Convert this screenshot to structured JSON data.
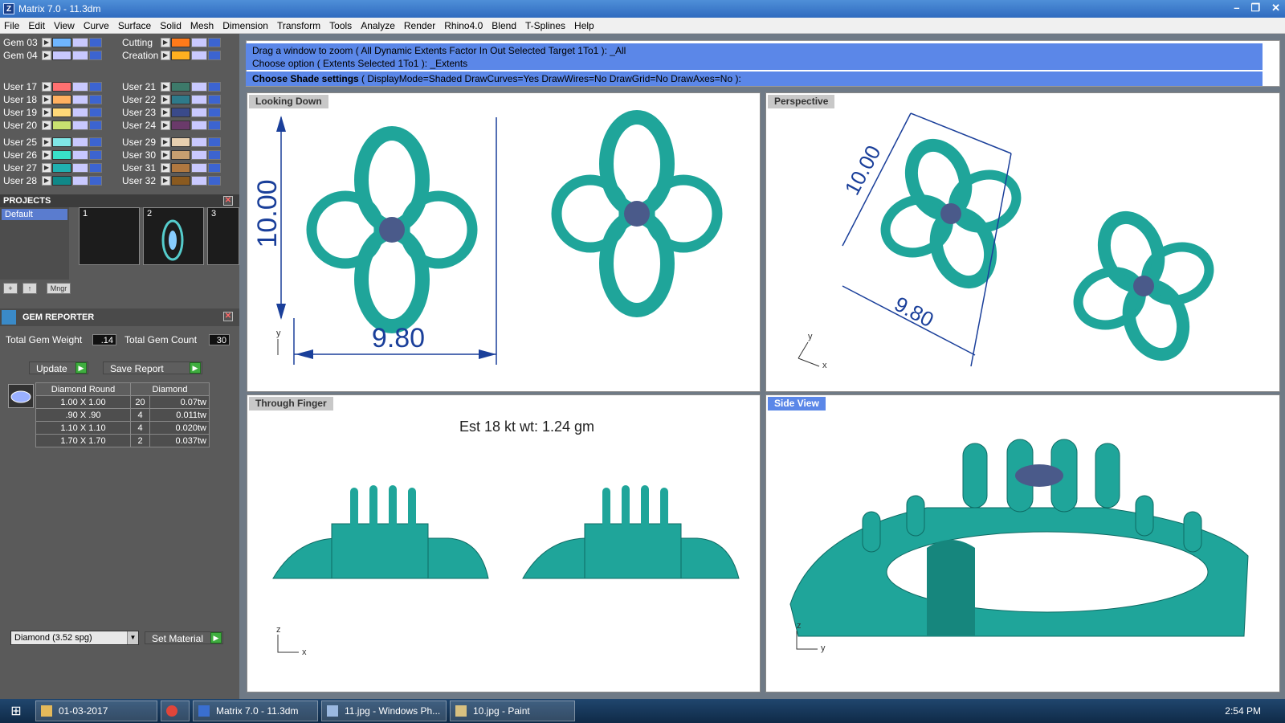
{
  "window": {
    "title": "Matrix 7.0 - 11.3dm",
    "app_icon": "Z"
  },
  "menu": [
    "File",
    "Edit",
    "View",
    "Curve",
    "Surface",
    "Solid",
    "Mesh",
    "Dimension",
    "Transform",
    "Tools",
    "Analyze",
    "Render",
    "Rhino4.0",
    "Blend",
    "T-Splines",
    "Help"
  ],
  "layers": {
    "left": [
      {
        "name": "Gem 03",
        "color": "#6fb6ff"
      },
      {
        "name": "Gem 04",
        "color": "#c8c8ff"
      },
      {
        "name": "User 17",
        "color": "#ff7070"
      },
      {
        "name": "User 18",
        "color": "#ffb060"
      },
      {
        "name": "User 19",
        "color": "#ffd878"
      },
      {
        "name": "User 20",
        "color": "#c8e070"
      },
      {
        "name": "User 25",
        "color": "#7fe6e6"
      },
      {
        "name": "User 26",
        "color": "#38e0c8"
      },
      {
        "name": "User 27",
        "color": "#20b0b0"
      },
      {
        "name": "User 28",
        "color": "#108888"
      }
    ],
    "right": [
      {
        "name": "Cutting",
        "color": "#ff7a1a"
      },
      {
        "name": "Creation",
        "color": "#ffb020"
      },
      {
        "name": "User 21",
        "color": "#3d7a6a"
      },
      {
        "name": "User 22",
        "color": "#2e7a8a"
      },
      {
        "name": "User 23",
        "color": "#3a4a8a"
      },
      {
        "name": "User 24",
        "color": "#6a3a6a"
      },
      {
        "name": "User 29",
        "color": "#e8d0b0"
      },
      {
        "name": "User 30",
        "color": "#c8a070"
      },
      {
        "name": "User 31",
        "color": "#b07840"
      },
      {
        "name": "User 32",
        "color": "#8a5a20"
      }
    ]
  },
  "projects": {
    "header": "PROJECTS",
    "default": "Default",
    "slots": [
      "1",
      "2",
      "3"
    ],
    "mngr": "Mngr"
  },
  "gem_reporter": {
    "header": "GEM REPORTER",
    "total_weight_label": "Total Gem Weight",
    "total_weight": ".14",
    "total_count_label": "Total Gem Count",
    "total_count": "30",
    "update": "Update",
    "save_report": "Save Report",
    "table": {
      "headers": [
        "Diamond Round",
        "Diamond"
      ],
      "rows": [
        {
          "size": "1.00 X 1.00",
          "count": "20",
          "wt": "0.07tw"
        },
        {
          "size": ".90 X .90",
          "count": "4",
          "wt": "0.011tw"
        },
        {
          "size": "1.10 X 1.10",
          "count": "4",
          "wt": "0.020tw"
        },
        {
          "size": "1.70 X 1.70",
          "count": "2",
          "wt": "0.037tw"
        }
      ]
    },
    "material": "Diamond      (3.52 spg)",
    "set_material": "Set Material"
  },
  "command": {
    "history1": "Drag a window to zoom ( All  Dynamic  Extents  Factor  In  Out  Selected  Target  1To1 ): _All",
    "history2": "Choose option ( Extents  Selected  1To1 ): _Extents",
    "prompt_label": "Choose Shade settings",
    "prompt_rest": "( DisplayMode=Shaded  DrawCurves=Yes  DrawWires=No  DrawGrid=No  DrawAxes=No ):"
  },
  "viewports": {
    "top_left": {
      "title": "Looking Down",
      "dim_v": "10.00",
      "dim_h": "9.80",
      "axis": "y"
    },
    "top_right": {
      "title": "Perspective",
      "dim_v": "10.00",
      "dim_h": "9.80",
      "axis_y": "y",
      "axis_x": "x"
    },
    "bottom_left": {
      "title": "Through Finger",
      "note": "Est 18 kt wt: 1.24 gm",
      "axis_z": "z",
      "axis_x": "x"
    },
    "bottom_right": {
      "title": "Side View",
      "axis_z": "z",
      "axis_y": "y"
    }
  },
  "colors": {
    "model": "#1fa59a",
    "model_dark": "#0e6b64",
    "gem": "#4a5a8a",
    "dim": "#1a3f9a",
    "active": "#5b87e8"
  },
  "taskbar": {
    "items": [
      "01-03-2017",
      "Matrix 7.0 - 11.3dm",
      "11.jpg - Windows Ph...",
      "10.jpg - Paint"
    ],
    "clock": "2:54 PM"
  }
}
